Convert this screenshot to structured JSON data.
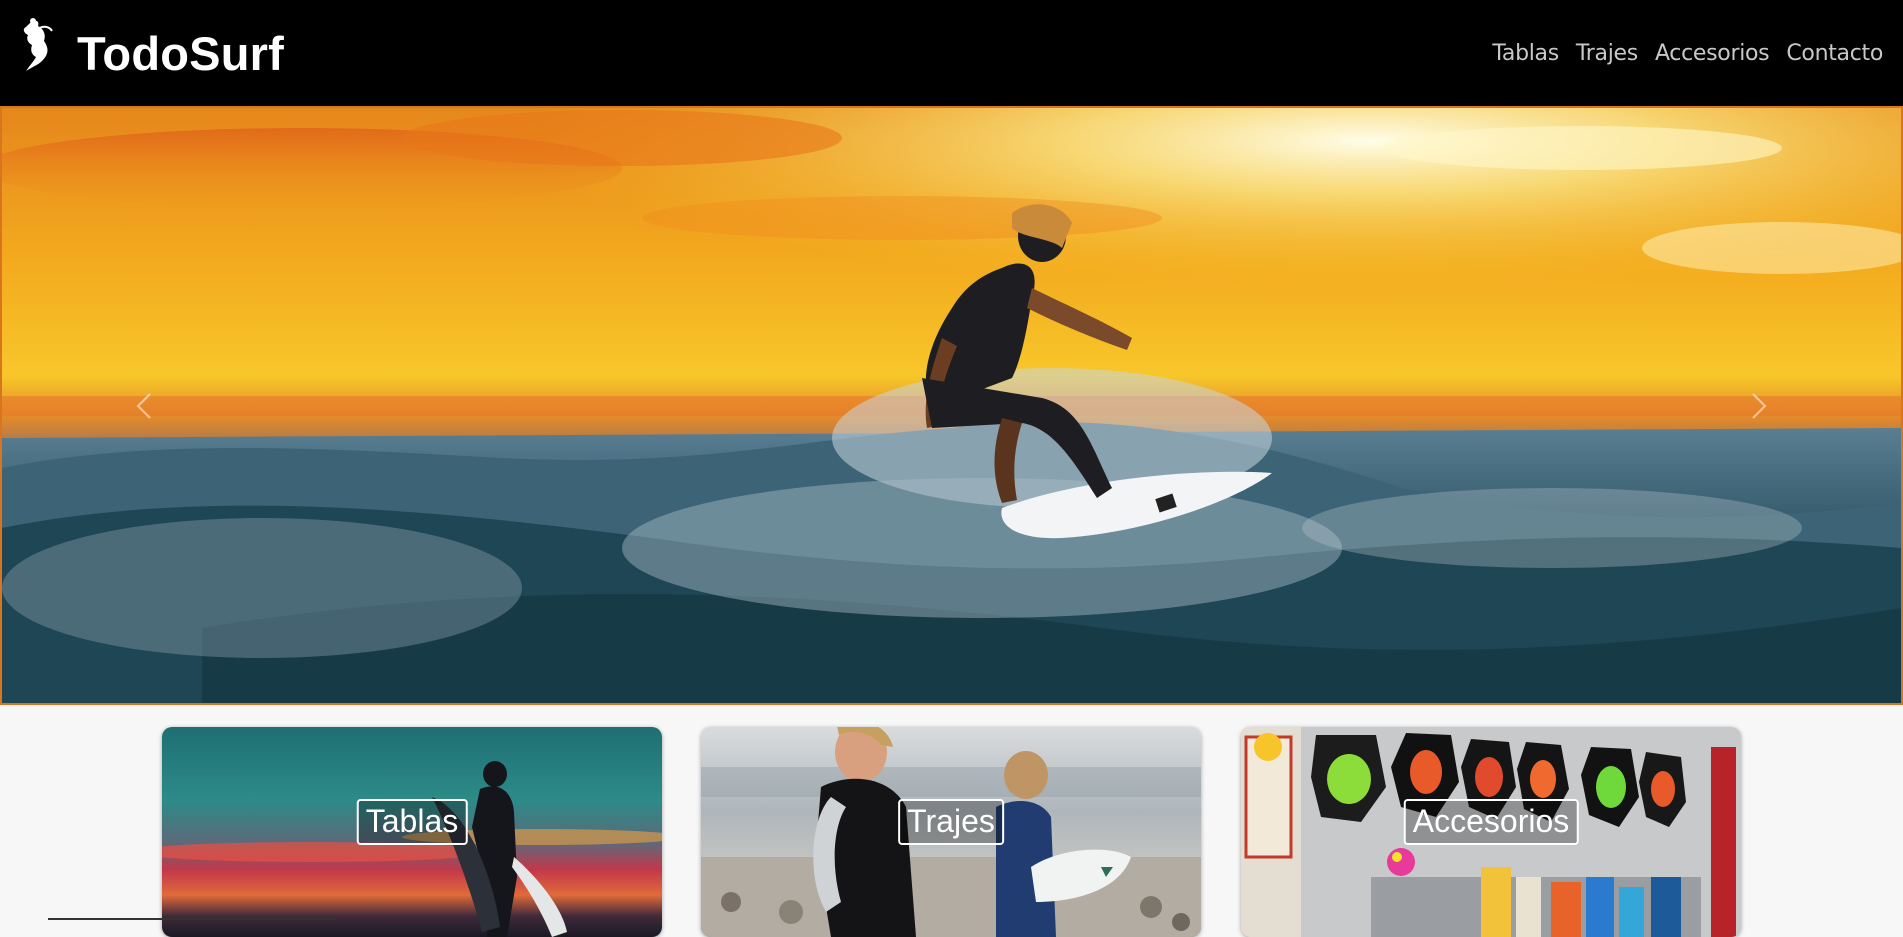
{
  "brand": {
    "name": "TodoSurf",
    "logo_icon": "surfer-logo-icon"
  },
  "nav": {
    "links": [
      {
        "label": "Tablas"
      },
      {
        "label": "Trajes"
      },
      {
        "label": "Accesorios"
      },
      {
        "label": "Contacto"
      }
    ]
  },
  "hero": {
    "image": "surfer-sunset-wave",
    "prev_icon": "chevron-left-icon",
    "next_icon": "chevron-right-icon"
  },
  "categories": [
    {
      "label": "Tablas",
      "image": "surfer-silhouette-sunset"
    },
    {
      "label": "Trajes",
      "image": "surfers-in-wetsuits"
    },
    {
      "label": "Accesorios",
      "image": "surf-accessories-shop-wall"
    }
  ],
  "colors": {
    "navbar_bg": "#000000",
    "hero_border": "#d9741f",
    "page_bg": "#f7f7f7"
  }
}
